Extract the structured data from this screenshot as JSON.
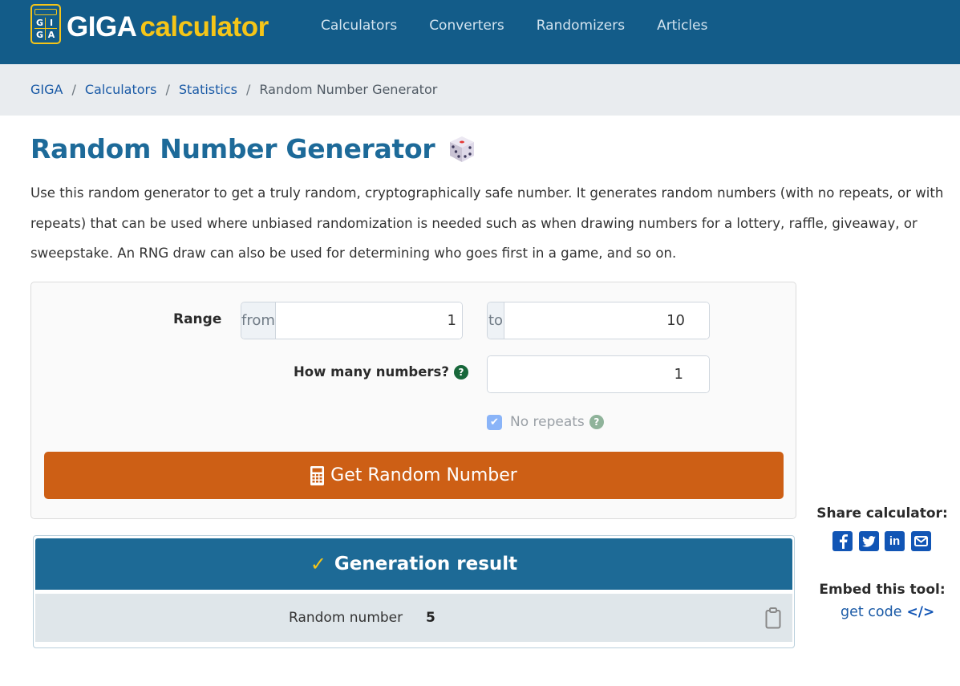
{
  "header": {
    "logo": {
      "grid_letters": [
        "G",
        "I",
        "G",
        "A"
      ],
      "brand_part1": "GIGA",
      "brand_part2": "calculator"
    },
    "nav": [
      {
        "label": "Calculators"
      },
      {
        "label": "Converters"
      },
      {
        "label": "Randomizers"
      },
      {
        "label": "Articles"
      }
    ]
  },
  "breadcrumb": {
    "items": [
      {
        "label": "GIGA"
      },
      {
        "label": "Calculators"
      },
      {
        "label": "Statistics"
      }
    ],
    "separator": "/",
    "current": "Random Number Generator"
  },
  "page": {
    "title": "Random Number Generator",
    "title_icon": "dice-icon",
    "description": "Use this random generator to get a truly random, cryptographically safe number. It generates random numbers (with no repeats, or with repeats) that can be used where unbiased randomization is needed such as when drawing numbers for a lottery, raffle, giveaway, or sweepstake. An RNG draw can also be used for determining who goes first in a game, and so on."
  },
  "form": {
    "range_label": "Range",
    "from_prefix": "from",
    "from_value": "1",
    "to_prefix": "to",
    "to_value": "10",
    "how_many_label": "How many numbers?",
    "how_many_value": "1",
    "help_glyph": "?",
    "no_repeats_label": "No repeats",
    "no_repeats_checked": true,
    "checkbox_glyph": "✔",
    "submit_label": "Get Random Number",
    "submit_icon": "calculator-icon",
    "accent_color": "#cd5f15"
  },
  "result": {
    "check_glyph": "✓",
    "heading": "Generation result",
    "row_label": "Random number",
    "row_value": "5",
    "copy_icon": "clipboard-icon"
  },
  "sidebar": {
    "share_title": "Share calculator:",
    "share_icons": [
      {
        "name": "facebook-icon",
        "glyph": "f"
      },
      {
        "name": "twitter-icon",
        "glyph": "t"
      },
      {
        "name": "linkedin-icon",
        "glyph": "in"
      },
      {
        "name": "email-icon",
        "glyph": "✉"
      }
    ],
    "embed_title": "Embed this tool:",
    "embed_link": "get code",
    "embed_icon_glyph": "</>"
  },
  "colors": {
    "header_bg": "#135c89",
    "brand_yellow": "#f5c518",
    "title_blue": "#1d6a99",
    "link_blue": "#1a5aa6",
    "button_orange": "#cd5f15",
    "result_header": "#1d6a96"
  }
}
